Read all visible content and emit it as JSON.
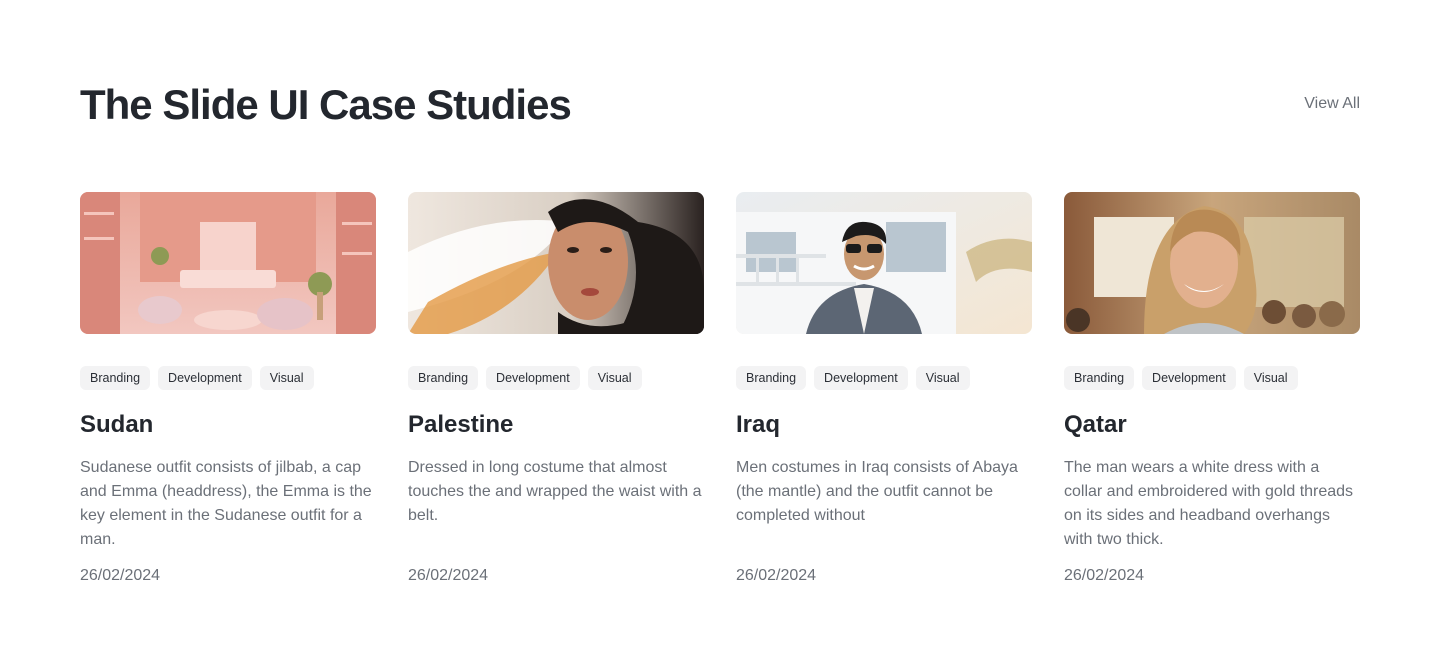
{
  "header": {
    "title": "The Slide UI Case Studies",
    "view_all": "View All"
  },
  "cards": [
    {
      "image": "pink-boutique-interior",
      "tags": [
        "Branding",
        "Development",
        "Visual"
      ],
      "title": "Sudan",
      "description": "Sudanese outfit consists of jilbab, a cap and Emma (headdress), the Emma is the key element in the Sudanese outfit for a man.",
      "date": "26/02/2024"
    },
    {
      "image": "woman-windswept-hair",
      "tags": [
        "Branding",
        "Development",
        "Visual"
      ],
      "title": "Palestine",
      "description": "Dressed in long costume that almost touches the and wrapped the waist with a belt.",
      "date": "26/02/2024"
    },
    {
      "image": "man-sunglasses-suit",
      "tags": [
        "Branding",
        "Development",
        "Visual"
      ],
      "title": "Iraq",
      "description": "Men costumes in Iraq consists of Abaya (the mantle) and the outfit cannot be completed without",
      "date": "26/02/2024"
    },
    {
      "image": "smiling-woman-classroom",
      "tags": [
        "Branding",
        "Development",
        "Visual"
      ],
      "title": "Qatar",
      "description": "The man wears a white dress with a collar and embroidered with gold threads on its sides and headband overhangs with two thick.",
      "date": "26/02/2024"
    }
  ]
}
